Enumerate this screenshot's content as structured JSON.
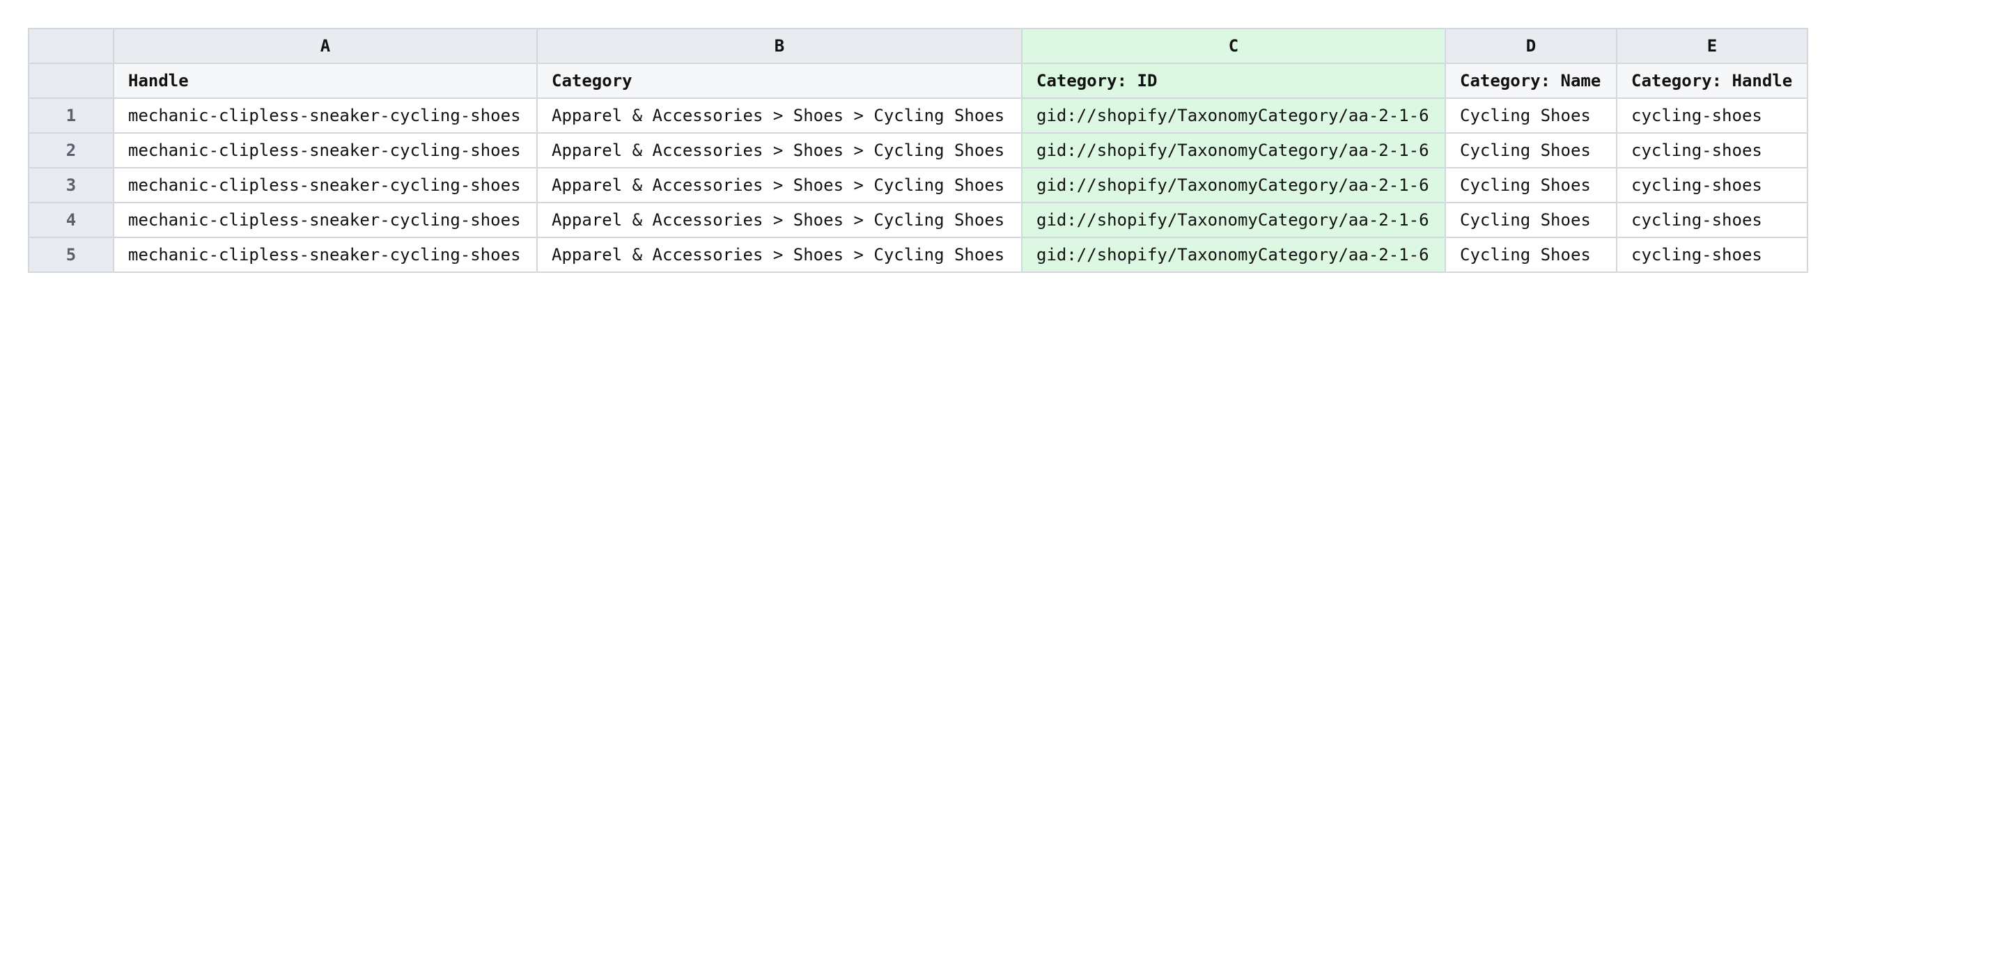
{
  "sheet": {
    "column_letters": [
      "A",
      "B",
      "C",
      "D",
      "E"
    ],
    "field_names": [
      "Handle",
      "Category",
      "Category: ID",
      "Category: Name",
      "Category: Handle"
    ],
    "highlighted_column": "C",
    "highlight_color": "#dcf8e2",
    "rows": [
      {
        "num": "1",
        "cells": [
          "mechanic-clipless-sneaker-cycling-shoes",
          "Apparel & Accessories > Shoes > Cycling Shoes",
          "gid://shopify/TaxonomyCategory/aa-2-1-6",
          "Cycling Shoes",
          "cycling-shoes"
        ]
      },
      {
        "num": "2",
        "cells": [
          "mechanic-clipless-sneaker-cycling-shoes",
          "Apparel & Accessories > Shoes > Cycling Shoes",
          "gid://shopify/TaxonomyCategory/aa-2-1-6",
          "Cycling Shoes",
          "cycling-shoes"
        ]
      },
      {
        "num": "3",
        "cells": [
          "mechanic-clipless-sneaker-cycling-shoes",
          "Apparel & Accessories > Shoes > Cycling Shoes",
          "gid://shopify/TaxonomyCategory/aa-2-1-6",
          "Cycling Shoes",
          "cycling-shoes"
        ]
      },
      {
        "num": "4",
        "cells": [
          "mechanic-clipless-sneaker-cycling-shoes",
          "Apparel & Accessories > Shoes > Cycling Shoes",
          "gid://shopify/TaxonomyCategory/aa-2-1-6",
          "Cycling Shoes",
          "cycling-shoes"
        ]
      },
      {
        "num": "5",
        "cells": [
          "mechanic-clipless-sneaker-cycling-shoes",
          "Apparel & Accessories > Shoes > Cycling Shoes",
          "gid://shopify/TaxonomyCategory/aa-2-1-6",
          "Cycling Shoes",
          "cycling-shoes"
        ]
      }
    ]
  }
}
